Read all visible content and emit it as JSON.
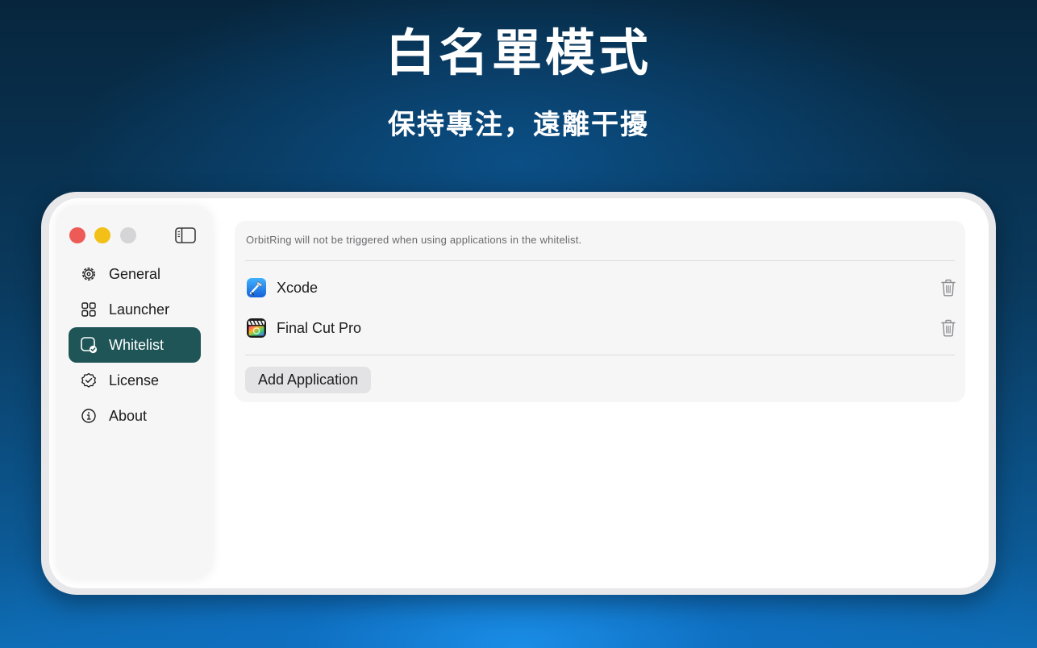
{
  "hero": {
    "title": "白名單模式",
    "subtitle": "保持專注，遠離干擾"
  },
  "sidebar": {
    "items": [
      {
        "label": "General",
        "icon": "gear-icon",
        "selected": false
      },
      {
        "label": "Launcher",
        "icon": "grid-icon",
        "selected": false
      },
      {
        "label": "Whitelist",
        "icon": "whitelist-icon",
        "selected": true
      },
      {
        "label": "License",
        "icon": "badge-check-icon",
        "selected": false
      },
      {
        "label": "About",
        "icon": "info-icon",
        "selected": false
      }
    ]
  },
  "whitelist": {
    "hint": "OrbitRing will not be triggered when using applications in the whitelist.",
    "apps": [
      {
        "name": "Xcode",
        "icon": "xcode-app-icon"
      },
      {
        "name": "Final Cut Pro",
        "icon": "final-cut-pro-app-icon"
      }
    ],
    "add_button_label": "Add Application"
  },
  "colors": {
    "accent_selected": "#1f5557",
    "traffic_close": "#ee5a56",
    "traffic_minimize": "#f2c017",
    "traffic_zoom": "#d5d5d7"
  }
}
